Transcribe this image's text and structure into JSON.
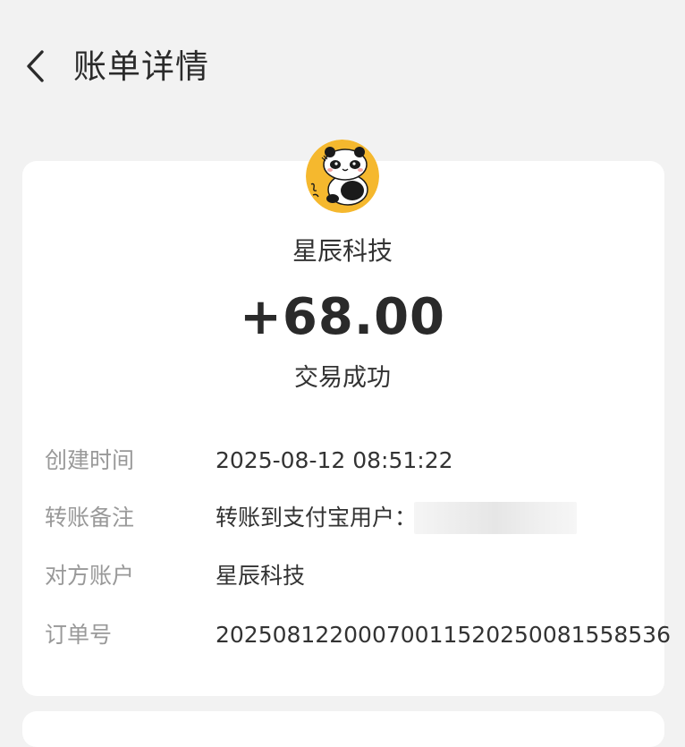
{
  "header": {
    "title": "账单详情"
  },
  "transaction": {
    "merchant": "星辰科技",
    "amount": "+68.00",
    "status": "交易成功"
  },
  "details": [
    {
      "label": "创建时间",
      "value": "2025-08-12 08:51:22"
    },
    {
      "label": "转账备注",
      "value": "转账到支付宝用户："
    },
    {
      "label": "对方账户",
      "value": "星辰科技"
    },
    {
      "label": "订单号",
      "value": "20250812200070011520250081558536"
    }
  ],
  "icons": {
    "back": "chevron-left-icon",
    "avatar": "panda-avatar"
  },
  "colors": {
    "background": "#f2f2f2",
    "card": "#ffffff",
    "avatar_bg": "#f5b82e",
    "label": "#999999",
    "text": "#333333"
  }
}
